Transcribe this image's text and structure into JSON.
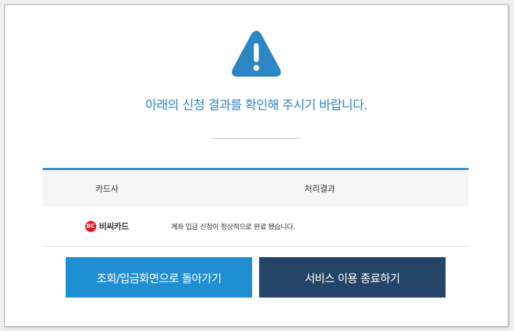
{
  "message": "아래의 신청 결과를 확인해 주시기 바랍니다.",
  "table": {
    "headers": {
      "card": "카드사",
      "result": "처리결과"
    },
    "rows": [
      {
        "card_logo_mark": "BC",
        "card_name": "비씨카드",
        "result": "계좌 입금 신청이 정상적으로 완료 됐습니다."
      }
    ]
  },
  "buttons": {
    "inquiry_label": "조회/입금화면으로 돌아가기",
    "exit_label": "서비스 이용 종료하기"
  },
  "icons": {
    "warning": "warning-triangle-icon"
  },
  "colors": {
    "accent": "#2d86c4",
    "inquiry_button": "#1f8fd2",
    "exit_button": "#244568",
    "card_brand": "#e11b25"
  }
}
